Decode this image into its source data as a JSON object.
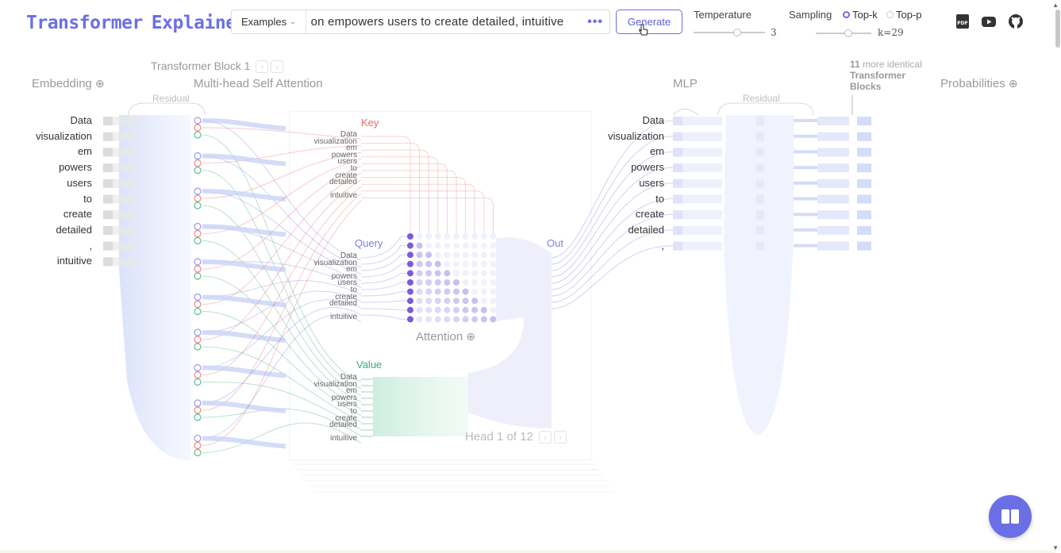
{
  "header": {
    "logo_part1": "Transformer",
    "logo_part2": "Explainer",
    "examples_label": "Examples",
    "prompt_text": "on empowers users to create detailed, intuitive",
    "generate_label": "Generate",
    "temperature_label": "Temperature",
    "temperature_value": "3",
    "sampling_label": "Sampling",
    "topk_label": "Top-k",
    "topp_label": "Top-p",
    "k_value": "k=29",
    "accent": "#6b6fe6"
  },
  "sections": {
    "embedding": "Embedding",
    "block_title": "Transformer Block 1",
    "mhsa": "Multi-head Self Attention",
    "residual_left": "Residual",
    "mlp": "MLP",
    "residual_right": "Residual",
    "probabilities": "Probabilities",
    "more_blocks_count": "11",
    "more_blocks_suffix": "more identical",
    "more_blocks_line2": "Transformer",
    "more_blocks_line3": "Blocks",
    "key": "Key",
    "query": "Query",
    "value": "Value",
    "out": "Out",
    "attention": "Attention",
    "head": "Head 1 of 12"
  },
  "tokens": [
    "Data",
    "visualization",
    "em",
    "powers",
    "users",
    "to",
    "create",
    "detailed",
    ",",
    "intuitive"
  ],
  "mlp_tokens": [
    "Data",
    "visualization",
    "em",
    "powers",
    "users",
    "to",
    "create",
    "detailed",
    ","
  ],
  "colors": {
    "key": "#e86a6a",
    "query": "#7d7de8",
    "value": "#3caa74"
  },
  "icons": [
    "pdf-icon",
    "youtube-icon",
    "github-icon",
    "book-icon"
  ]
}
